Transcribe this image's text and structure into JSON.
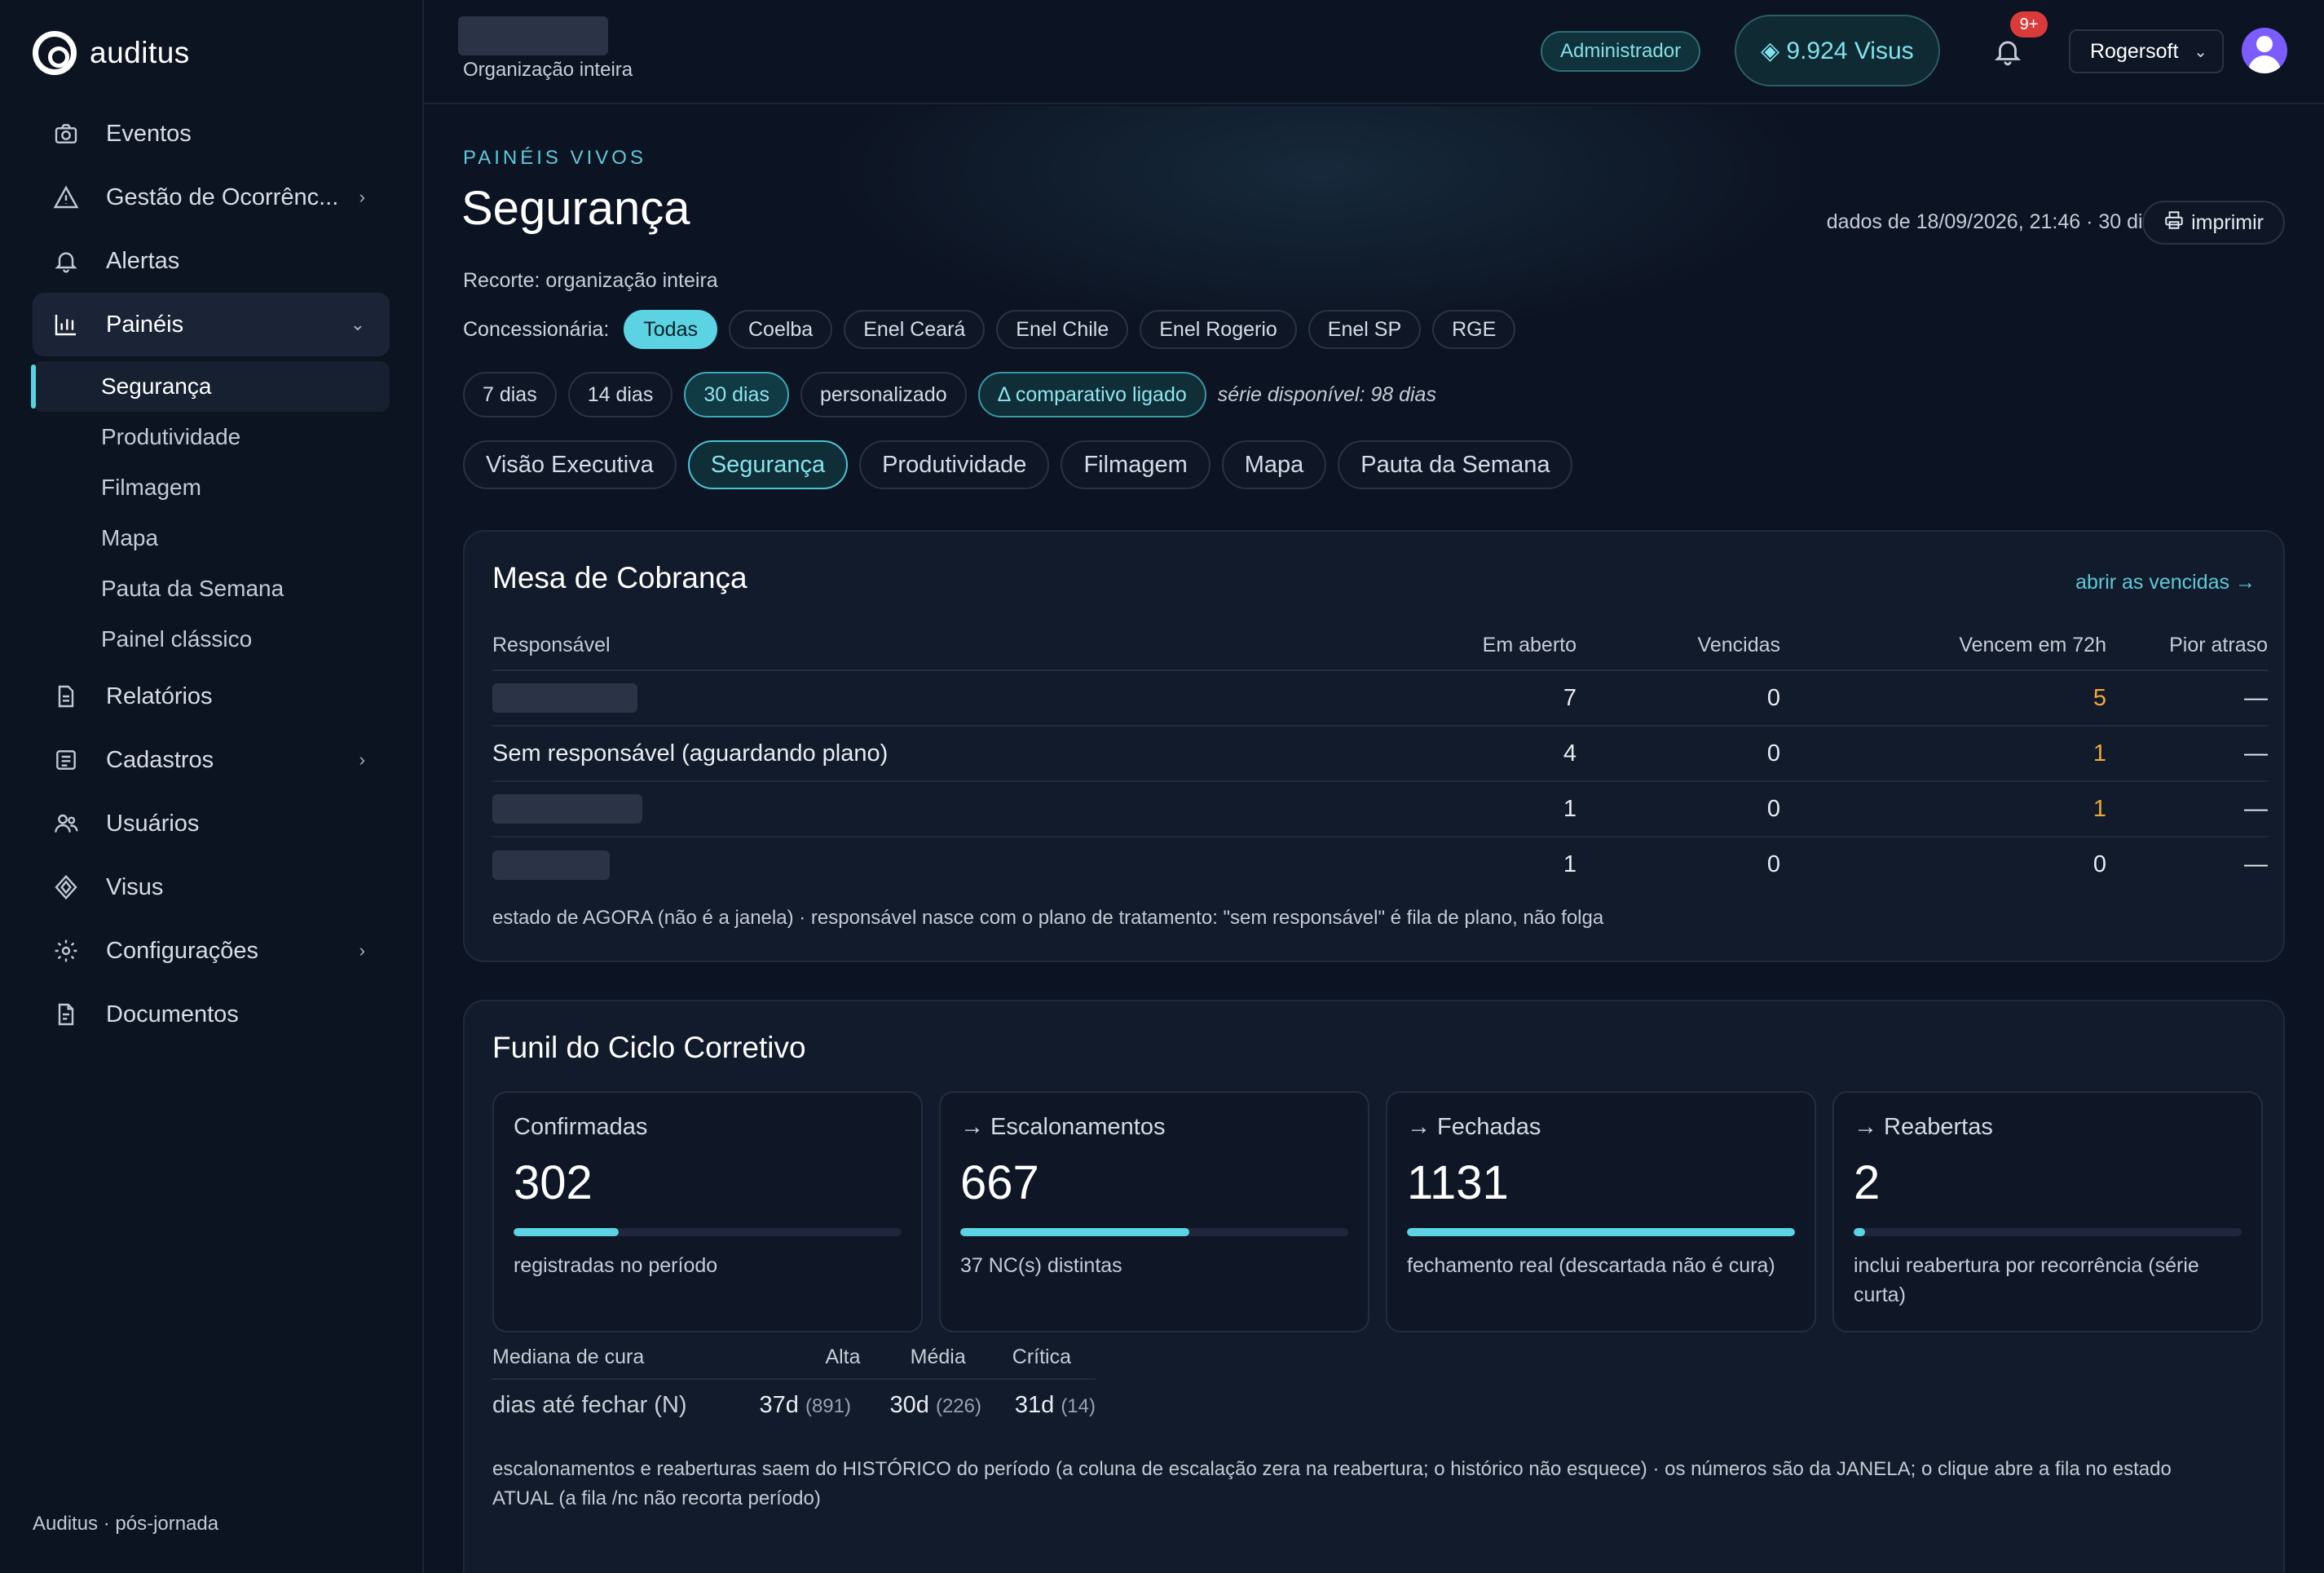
{
  "app": {
    "name": "auditus"
  },
  "sidebar": {
    "items": [
      {
        "label": "Eventos",
        "icon": "camera-icon"
      },
      {
        "label": "Gestão de Ocorrênc...",
        "icon": "warning-icon",
        "chevron": "›"
      },
      {
        "label": "Alertas",
        "icon": "bell-icon"
      },
      {
        "label": "Painéis",
        "icon": "bar-chart-icon",
        "chevron": "⌄"
      }
    ],
    "sub_items": [
      "Segurança",
      "Produtividade",
      "Filmagem",
      "Mapa",
      "Pauta da Semana",
      "Painel clássico"
    ],
    "items_after": [
      {
        "label": "Relatórios",
        "icon": "file-icon"
      },
      {
        "label": "Cadastros",
        "icon": "list-icon",
        "chevron": "›"
      },
      {
        "label": "Usuários",
        "icon": "users-icon"
      },
      {
        "label": "Visus",
        "icon": "diamond-icon"
      },
      {
        "label": "Configurações",
        "icon": "gear-icon",
        "chevron": "›"
      },
      {
        "label": "Documentos",
        "icon": "document-icon"
      }
    ],
    "footer": "Auditus · pós-jornada"
  },
  "header": {
    "org_label": "Organização inteira",
    "role_badge": "Administrador",
    "visus": "◈ 9.924 Visus",
    "notifications": "9+",
    "user": "Rogersoft"
  },
  "page": {
    "eyebrow": "PAINÉIS VIVOS",
    "title": "Segurança",
    "data_stamp": "dados de 18/09/2026, 21:46 · 30 dias",
    "print": "imprimir",
    "recorte": "Recorte: organização inteira",
    "concessionaria_label": "Concessionária:",
    "concessionarias": [
      "Todas",
      "Coelba",
      "Enel Ceará",
      "Enel Chile",
      "Enel Rogerio",
      "Enel SP",
      "RGE"
    ],
    "periods": [
      "7 dias",
      "14 dias",
      "30 dias",
      "personalizado"
    ],
    "comparativo": "Δ comparativo ligado",
    "serie": "série disponível: 98 dias",
    "tabs": [
      "Visão Executiva",
      "Segurança",
      "Produtividade",
      "Filmagem",
      "Mapa",
      "Pauta da Semana"
    ]
  },
  "mesa": {
    "title": "Mesa de Cobrança",
    "link": "abrir as vencidas →",
    "columns": [
      "Responsável",
      "Em aberto",
      "Vencidas",
      "Vencem em 72h",
      "Pior atraso"
    ],
    "rows": [
      {
        "name": "",
        "aberto": "7",
        "vencidas": "0",
        "vencem": "5",
        "pior": "—"
      },
      {
        "name": "Sem responsável (aguardando plano)",
        "aberto": "4",
        "vencidas": "0",
        "vencem": "1",
        "pior": "—"
      },
      {
        "name": "",
        "aberto": "1",
        "vencidas": "0",
        "vencem": "1",
        "pior": "—"
      },
      {
        "name": "",
        "aberto": "1",
        "vencidas": "0",
        "vencem": "0",
        "pior": "—"
      }
    ],
    "note": "estado de AGORA (não é a janela) · responsável nasce com o plano de tratamento: \"sem responsável\" é fila de plano, não folga"
  },
  "funil": {
    "title": "Funil do Ciclo Corretivo",
    "stages": [
      {
        "label": "Confirmadas",
        "value": "302",
        "fraction": 0.27,
        "caption": "registradas no período"
      },
      {
        "label": "→ Escalonamentos",
        "value": "667",
        "fraction": 0.59,
        "caption": "37 NC(s) distintas"
      },
      {
        "label": "→ Fechadas",
        "value": "1131",
        "fraction": 1.0,
        "caption": "fechamento real (descartada não é cura)"
      },
      {
        "label": "→ Reabertas",
        "value": "2",
        "fraction": 0.03,
        "caption": "inclui reabertura por recorrência (série curta)"
      }
    ],
    "cure": {
      "head": [
        "Mediana de cura",
        "Alta",
        "Média",
        "Crítica"
      ],
      "row_label": "dias até fechar (N)",
      "values": [
        {
          "d": "37d",
          "n": "(891)"
        },
        {
          "d": "30d",
          "n": "(226)"
        },
        {
          "d": "31d",
          "n": "(14)"
        }
      ]
    },
    "note": "escalonamentos e reaberturas saem do HISTÓRICO do período (a coluna de escalação zera na reabertura; o histórico não esquece) · os números são da JANELA; o clique abre a fila no estado ATUAL (a fila /nc não recorta período)"
  }
}
